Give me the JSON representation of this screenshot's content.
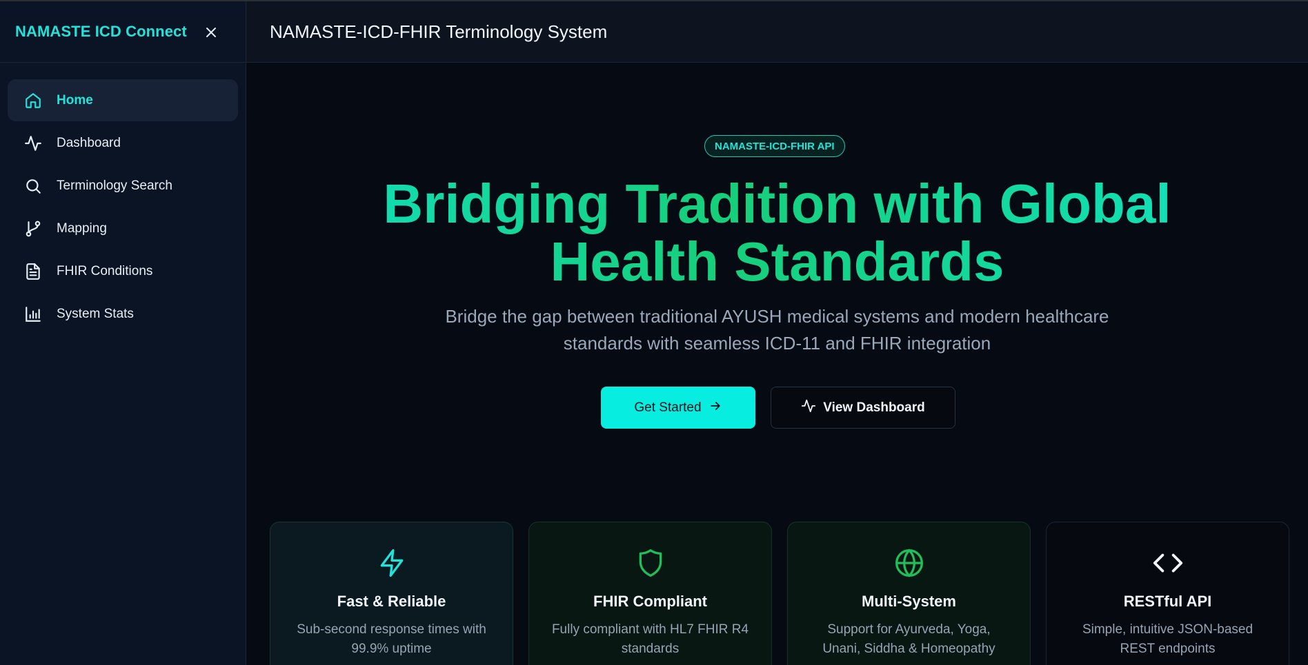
{
  "sidebar": {
    "brand": "NAMASTE ICD Connect",
    "items": [
      {
        "label": "Home",
        "icon": "home-icon",
        "active": true
      },
      {
        "label": "Dashboard",
        "icon": "activity-icon"
      },
      {
        "label": "Terminology Search",
        "icon": "search-icon"
      },
      {
        "label": "Mapping",
        "icon": "git-branch-icon"
      },
      {
        "label": "FHIR Conditions",
        "icon": "file-text-icon"
      },
      {
        "label": "System Stats",
        "icon": "bar-chart-icon"
      }
    ]
  },
  "header": {
    "title": "NAMASTE-ICD-FHIR Terminology System"
  },
  "hero": {
    "badge": "NAMASTE-ICD-FHIR API",
    "title_line1": "Bridging Tradition with Global",
    "title_line2": "Health Standards",
    "subtitle": "Bridge the gap between traditional AYUSH medical systems and modern healthcare standards with seamless ICD-11 and FHIR integration",
    "primary_button": "Get Started",
    "secondary_button": "View Dashboard"
  },
  "features": [
    {
      "title": "Fast & Reliable",
      "desc": "Sub-second response times with 99.9% uptime",
      "icon": "zap-icon"
    },
    {
      "title": "FHIR Compliant",
      "desc": "Fully compliant with HL7 FHIR R4 standards",
      "icon": "shield-icon"
    },
    {
      "title": "Multi-System",
      "desc": "Support for Ayurveda, Yoga, Unani, Siddha & Homeopathy",
      "icon": "globe-icon"
    },
    {
      "title": "RESTful API",
      "desc": "Simple, intuitive JSON-based REST endpoints",
      "icon": "code-icon"
    }
  ],
  "colors": {
    "accent": "#22e3d9",
    "primary_button": "#07ede0",
    "green": "#1fbf5b",
    "background": "#050a13",
    "sidebar": "#0b1425"
  }
}
